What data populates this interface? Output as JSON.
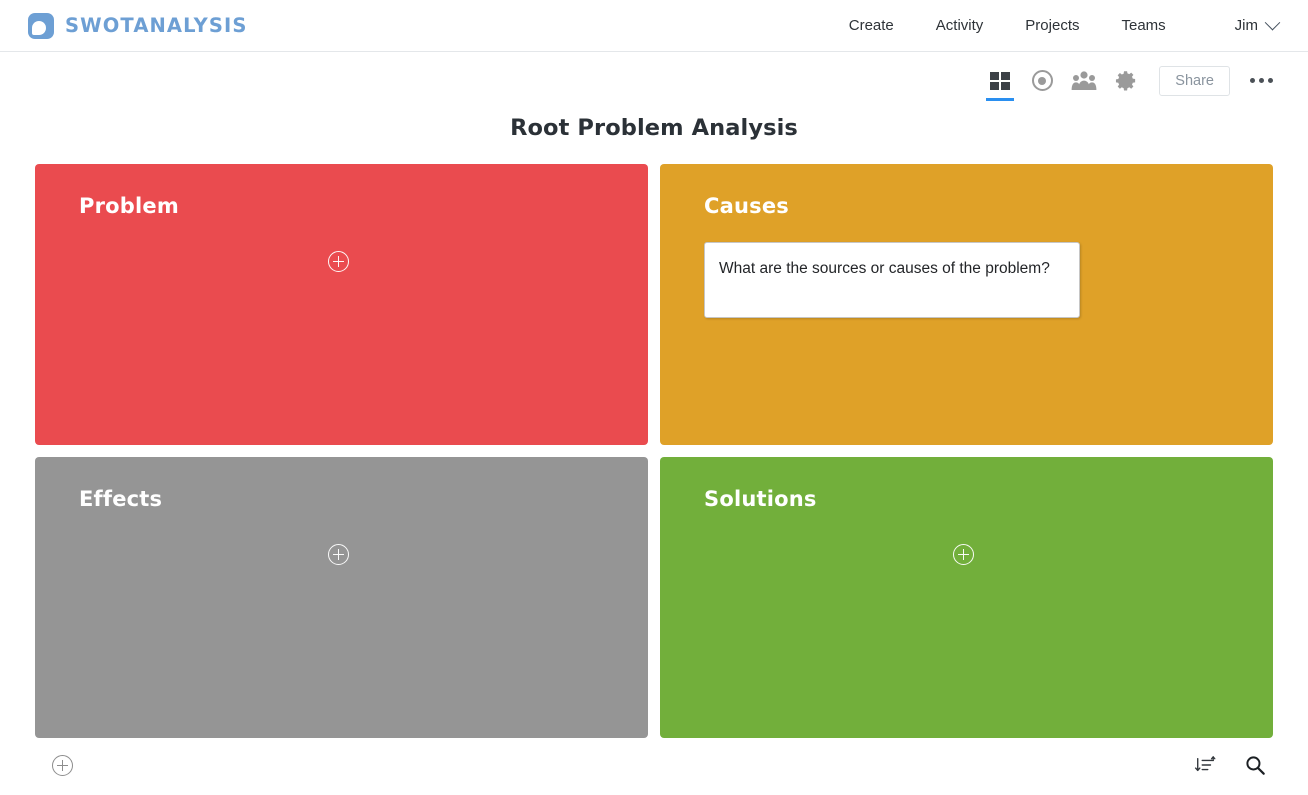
{
  "header": {
    "brand_name": "SWOTANALYSIS",
    "logo_icon": "swot-logo-icon",
    "nav": [
      {
        "label": "Create",
        "name": "nav-create"
      },
      {
        "label": "Activity",
        "name": "nav-activity"
      },
      {
        "label": "Projects",
        "name": "nav-projects"
      },
      {
        "label": "Teams",
        "name": "nav-teams"
      }
    ],
    "user": {
      "name": "Jim",
      "chevron_icon": "chevron-down-icon"
    }
  },
  "toolbar": {
    "items": [
      {
        "name": "grid-view-icon",
        "label": "grid-icon",
        "active": true
      },
      {
        "name": "target-view-icon",
        "label": "bullseye-icon",
        "active": false
      },
      {
        "name": "team-icon",
        "label": "people-icon",
        "active": false
      },
      {
        "name": "settings-icon",
        "label": "gear-icon",
        "active": false
      }
    ],
    "share_label": "Share",
    "more_icon": "ellipsis-icon"
  },
  "board": {
    "title": "Root Problem Analysis",
    "quadrants": [
      {
        "title": "Problem",
        "color": "#EA4B4F",
        "name": "quadrant-problem",
        "add_icon": "plus-circle-icon",
        "notes": []
      },
      {
        "title": "Causes",
        "color": "#DFA128",
        "name": "quadrant-causes",
        "add_icon": "plus-circle-icon",
        "notes": [
          {
            "text": "What are the sources or causes of the problem?"
          }
        ]
      },
      {
        "title": "Effects",
        "color": "#959595",
        "name": "quadrant-effects",
        "add_icon": "plus-circle-icon",
        "notes": []
      },
      {
        "title": "Solutions",
        "color": "#72AF3B",
        "name": "quadrant-solutions",
        "add_icon": "plus-circle-icon",
        "notes": []
      }
    ]
  },
  "bottom_bar": {
    "add_icon": "plus-circle-icon",
    "sort_icon": "sort-icon",
    "search_icon": "search-icon"
  },
  "colors": {
    "brand_blue": "#6D9FD4",
    "accent_blue": "#2A8FF0",
    "problem_red": "#EA4B4F",
    "causes_orange": "#DFA128",
    "effects_gray": "#959595",
    "solutions_green": "#72AF3B"
  }
}
